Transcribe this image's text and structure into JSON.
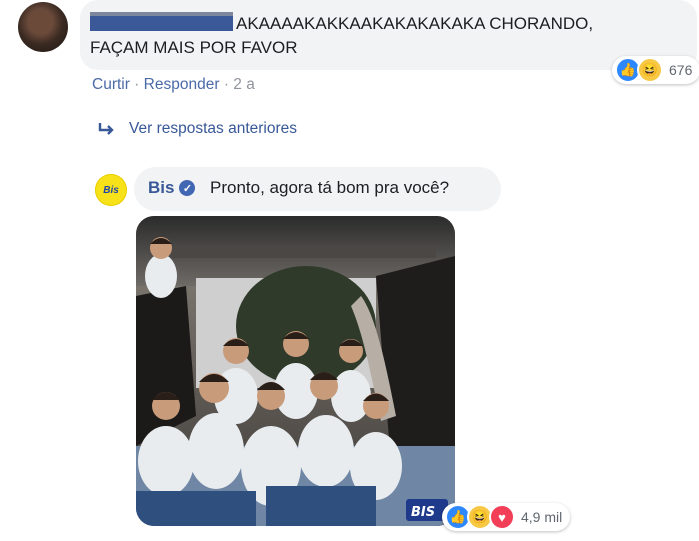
{
  "comment1": {
    "text_line1": "AKAAAAKAKKAAKAKAKAKAKA CHORANDO,",
    "text_line2": "FAÇAM MAIS POR FAVOR",
    "reaction_count": "676",
    "actions": {
      "like": "Curtir",
      "reply": "Responder",
      "time": "2 a"
    }
  },
  "view_previous": "Ver respostas anteriores",
  "comment2": {
    "author": "Bis",
    "avatar_label": "Bis",
    "text": "Pronto, agora tá bom pra você?",
    "reaction_count": "4,9 mil",
    "watermark": "BIS"
  },
  "colors": {
    "link": "#385898",
    "bubble": "#f2f3f5",
    "like": "#2d88ff",
    "love": "#f33e58",
    "haha": "#f7c843"
  }
}
